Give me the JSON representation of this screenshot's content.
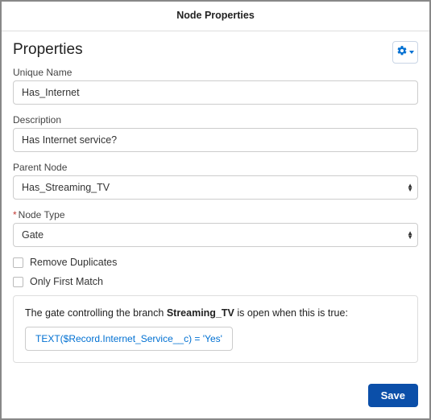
{
  "window": {
    "title": "Node Properties"
  },
  "section": {
    "title": "Properties"
  },
  "fields": {
    "uniqueName": {
      "label": "Unique Name",
      "value": "Has_Internet"
    },
    "description": {
      "label": "Description",
      "value": "Has Internet service?"
    },
    "parentNode": {
      "label": "Parent Node",
      "value": "Has_Streaming_TV"
    },
    "nodeType": {
      "label": "Node Type",
      "value": "Gate",
      "required": "*"
    }
  },
  "checks": {
    "removeDuplicates": {
      "label": "Remove Duplicates"
    },
    "onlyFirstMatch": {
      "label": "Only First Match"
    }
  },
  "gate": {
    "prefix": "The gate controlling the branch ",
    "branch": "Streaming_TV",
    "suffix": " is open when this is true:",
    "formula": "TEXT($Record.Internet_Service__c) = 'Yes'"
  },
  "footer": {
    "save": "Save"
  }
}
